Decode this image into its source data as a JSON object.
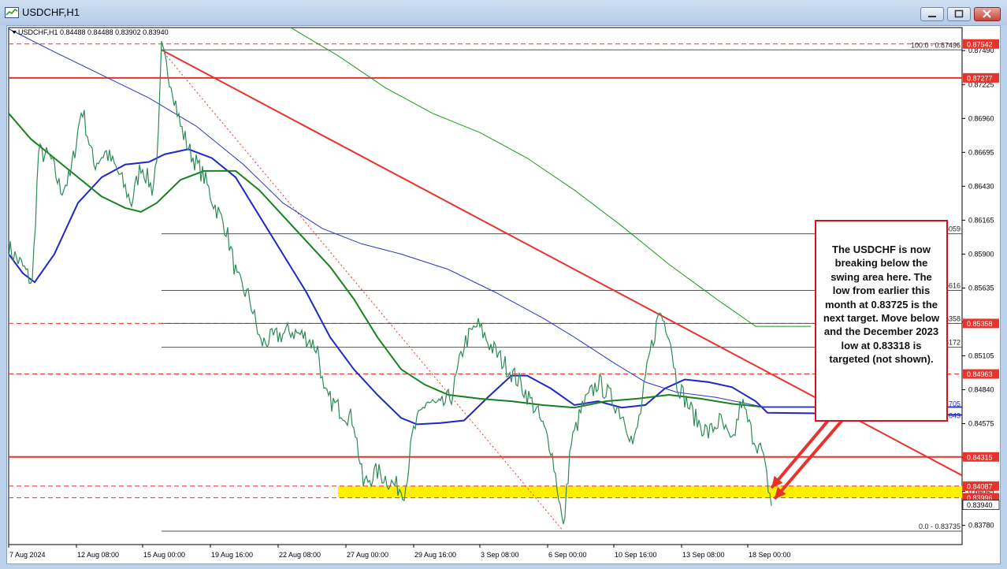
{
  "window": {
    "title": "USDCHF,H1"
  },
  "chart_data": {
    "type": "line",
    "symbol_info": "USDCHF,H1  0.84488 0.84488 0.83902 0.83940",
    "title": "",
    "xlabel": "",
    "ylabel": "",
    "ylim": [
      0.8363,
      0.8767
    ],
    "y_ticks": [
      "0.87490",
      "0.87225",
      "0.86960",
      "0.86695",
      "0.86430",
      "0.86165",
      "0.85900",
      "0.85635",
      "0.85370",
      "0.85105",
      "0.84840",
      "0.84575",
      "0.84310",
      "0.84045",
      "0.83780"
    ],
    "x_ticks": [
      "7 Aug 2024",
      "12 Aug 08:00",
      "15 Aug 00:00",
      "19 Aug 16:00",
      "22 Aug 08:00",
      "27 Aug 00:00",
      "29 Aug 16:00",
      "3 Sep 08:00",
      "6 Sep 00:00",
      "10 Sep 16:00",
      "13 Sep 08:00",
      "18 Sep 00:00"
    ],
    "price_labels": [
      {
        "text": "0.87542",
        "value": 0.87542,
        "bg": "#e8332c"
      },
      {
        "text": "0.87277",
        "value": 0.87277,
        "bg": "#e8332c"
      },
      {
        "text": "0.85358",
        "value": 0.85358,
        "bg": "#e8332c"
      },
      {
        "text": "0.84963",
        "value": 0.84963,
        "bg": "#e8332c"
      },
      {
        "text": "0.84315",
        "value": 0.84315,
        "bg": "#e8332c"
      },
      {
        "text": "0.84087",
        "value": 0.84087,
        "bg": "#e8332c"
      },
      {
        "text": "0.83996",
        "value": 0.83996,
        "bg": "#e8332c"
      },
      {
        "text": "0.83940",
        "value": 0.8394,
        "bg": "#ffffff"
      }
    ],
    "horizontal_levels": [
      {
        "value": 0.87542,
        "style": "dashed",
        "color": "#e8332c"
      },
      {
        "value": 0.87277,
        "style": "solid",
        "color": "#e8332c"
      },
      {
        "value": 0.85358,
        "style": "dashed",
        "color": "#e8332c"
      },
      {
        "value": 0.84963,
        "style": "dashed",
        "color": "#e8332c"
      },
      {
        "value": 0.84315,
        "style": "solid",
        "color": "#e8332c"
      },
      {
        "value": 0.84087,
        "style": "dashed",
        "color": "#e8332c"
      },
      {
        "value": 0.83996,
        "style": "dashed",
        "color": "#e8332c"
      }
    ],
    "fib_levels": [
      {
        "value": 0.87496,
        "label": "100.0 - 0.87496"
      },
      {
        "value": 0.86059,
        "label": "86059"
      },
      {
        "value": 0.85616,
        "label": "85616"
      },
      {
        "value": 0.85358,
        "label": "85358"
      },
      {
        "value": 0.85172,
        "label": "85172"
      },
      {
        "value": 0.83735,
        "label": "0.0 - 0.83735"
      }
    ],
    "ma_labels": [
      "H1 MA:200:0:0: 0.84705",
      "H1 MA:100:0:0: 0.84643"
    ],
    "swing_zone": {
      "from": 0.83996,
      "to": 0.84087,
      "color": "#ffef00"
    },
    "colors": {
      "price": "#2e8b57",
      "ma100": "#1f27c8",
      "ma200": "#17821f",
      "ma_long_blue": "#2a36c8",
      "ma_long_green": "#1a9a1a",
      "trend": "#e8332c",
      "arrow": "#e8332c"
    }
  },
  "note": {
    "text": "The USDCHF is now breaking below the swing area here.  The low from earlier this month at 0.83725 is the next target.  Move below and the December 2023 low at 0.83318 is targeted (not shown)."
  }
}
